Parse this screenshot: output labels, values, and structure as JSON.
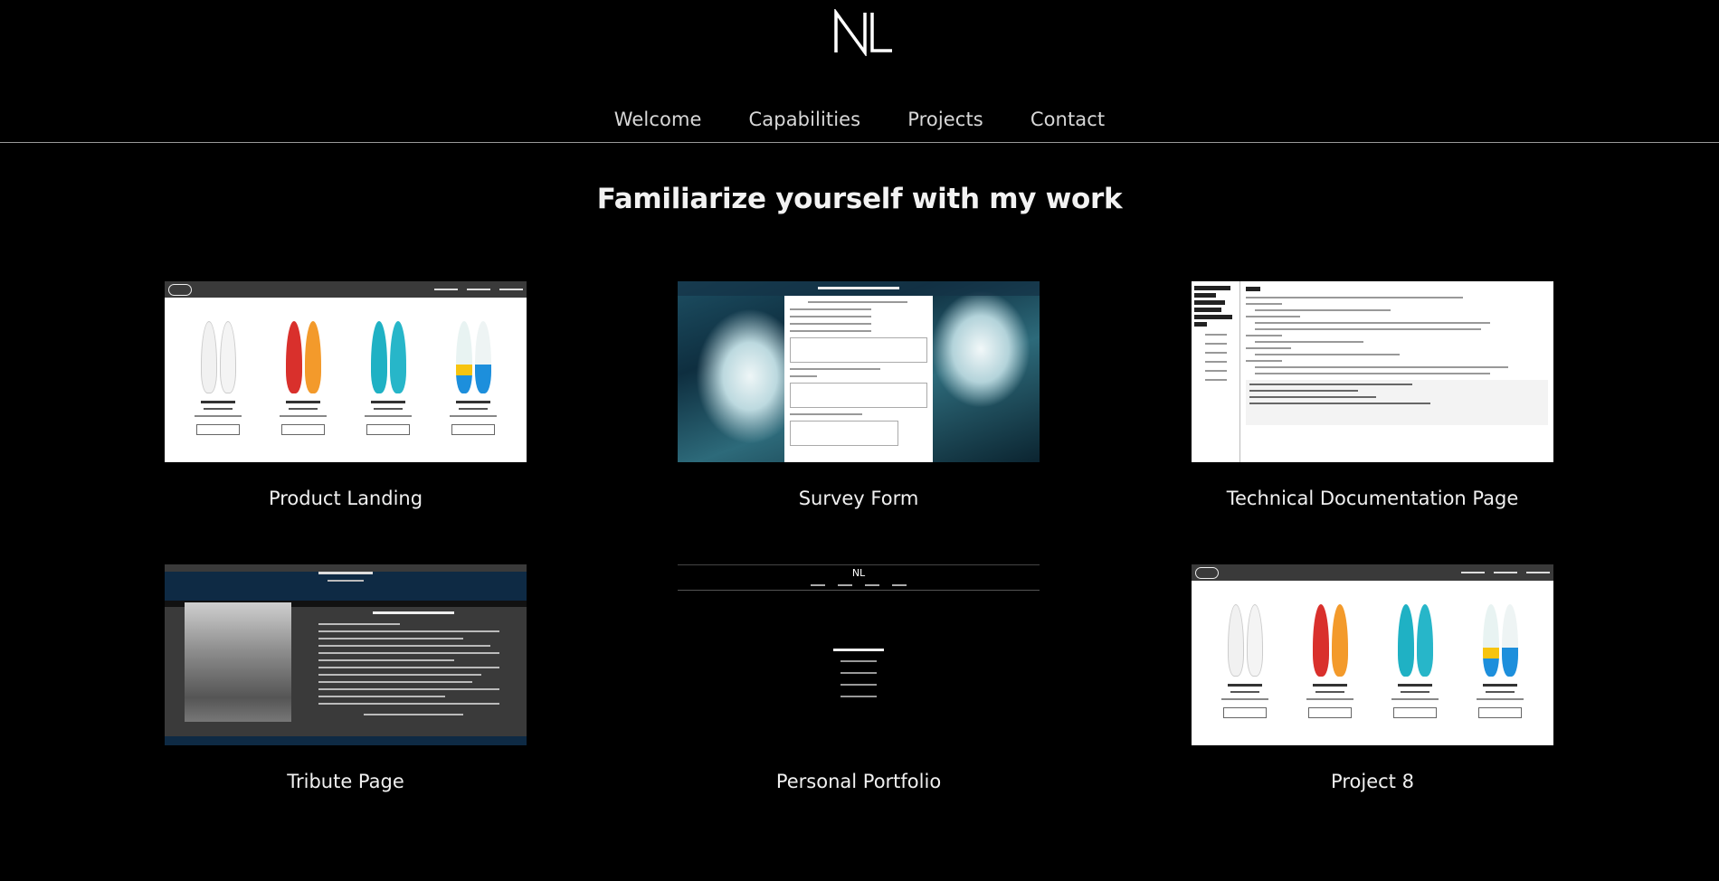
{
  "header": {
    "logo_text": "NL",
    "nav": [
      {
        "label": "Welcome"
      },
      {
        "label": "Capabilities"
      },
      {
        "label": "Projects"
      },
      {
        "label": "Contact"
      }
    ]
  },
  "main": {
    "heading": "Familiarize yourself with my work",
    "projects": [
      {
        "title": "Product Landing"
      },
      {
        "title": "Survey Form"
      },
      {
        "title": "Technical Documentation Page"
      },
      {
        "title": "Tribute Page"
      },
      {
        "title": "Personal Portfolio"
      },
      {
        "title": "Project 8"
      }
    ]
  },
  "colors": {
    "background": "#000000",
    "text": "#f0f0f0",
    "nav_text": "#d8d8d8",
    "divider": "#9a9a9a"
  }
}
